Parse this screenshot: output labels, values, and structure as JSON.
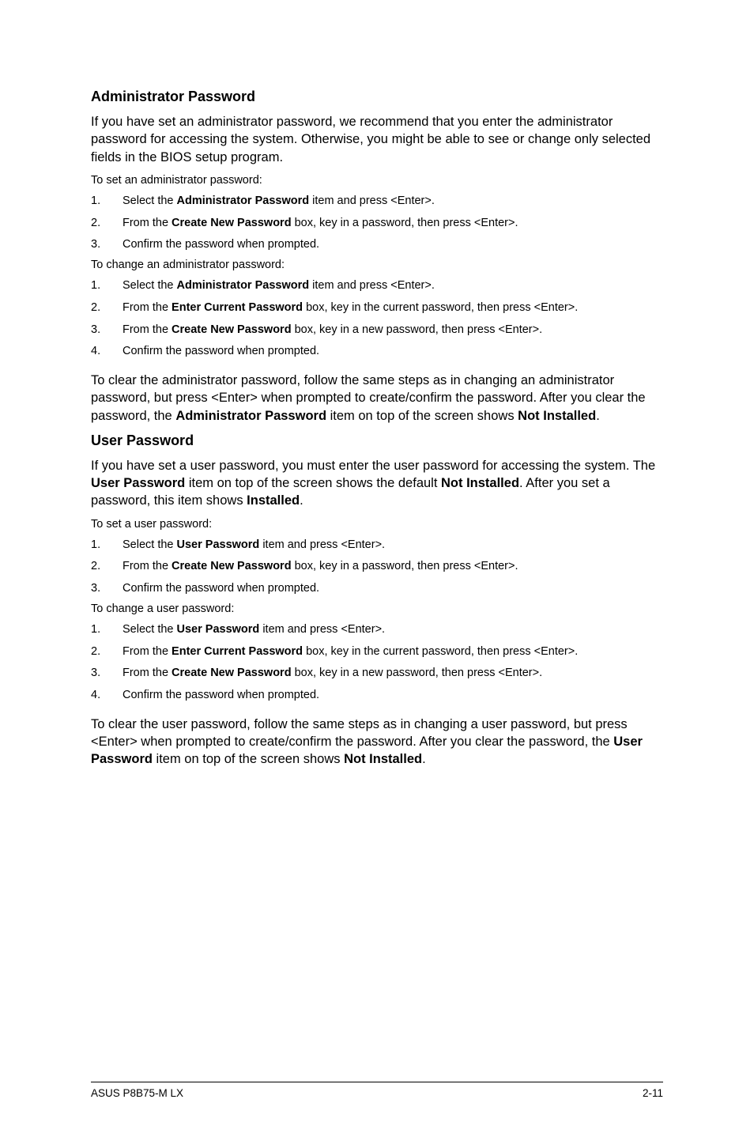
{
  "section1": {
    "heading": "Administrator Password",
    "intro": "If you have set an administrator password, we recommend that you enter the administrator password for accessing the system. Otherwise, you might be able to see or change only selected fields in the BIOS setup program.",
    "setLead": "To set an administrator password:",
    "set1_a": "Select the ",
    "set1_b": "Administrator Password",
    "set1_c": " item and press <Enter>.",
    "set2_a": "From the ",
    "set2_b": "Create New Password",
    "set2_c": " box, key in a password, then press <Enter>.",
    "set3": "Confirm the password when prompted.",
    "changeLead": "To change an administrator password:",
    "chg1_a": "Select the ",
    "chg1_b": "Administrator Password",
    "chg1_c": " item and press <Enter>.",
    "chg2_a": "From the ",
    "chg2_b": "Enter Current Password",
    "chg2_c": " box, key in the current password, then press <Enter>.",
    "chg3_a": "From the ",
    "chg3_b": "Create New Password",
    "chg3_c": " box, key in a new password, then press <Enter>.",
    "chg4": "Confirm the password when prompted.",
    "clear_a": "To clear the administrator password, follow the same steps as in changing an administrator password, but press <Enter> when prompted to create/confirm the password. After you clear the password, the ",
    "clear_b": "Administrator Password",
    "clear_c": " item on top of the screen shows ",
    "clear_d": "Not Installed",
    "clear_e": "."
  },
  "section2": {
    "heading": "User Password",
    "intro_a": "If you have set a user password, you must enter the user password for accessing the system. The ",
    "intro_b": "User Password",
    "intro_c": " item on top of the screen shows the default ",
    "intro_d": "Not Installed",
    "intro_e": ". After you set a password, this item shows ",
    "intro_f": "Installed",
    "intro_g": ".",
    "setLead": "To set a user password:",
    "set1_a": "Select the ",
    "set1_b": "User Password",
    "set1_c": " item and press <Enter>.",
    "set2_a": "From the ",
    "set2_b": "Create New Password",
    "set2_c": " box, key in a password, then press <Enter>.",
    "set3": "Confirm the password when prompted.",
    "changeLead": "To change a user password:",
    "chg1_a": "Select the ",
    "chg1_b": "User Password",
    "chg1_c": " item and press <Enter>.",
    "chg2_a": "From the ",
    "chg2_b": "Enter Current Password",
    "chg2_c": " box, key in the current password, then press <Enter>.",
    "chg3_a": "From the ",
    "chg3_b": "Create New Password",
    "chg3_c": " box, key in a new password, then press <Enter>.",
    "chg4": "Confirm the password when prompted.",
    "clear_a": "To clear the user password, follow the same steps as in changing a user password, but press <Enter> when prompted to create/confirm the password. After you clear the password, the ",
    "clear_b": "User Password",
    "clear_c": " item on top of the screen shows ",
    "clear_d": "Not Installed",
    "clear_e": "."
  },
  "footer": {
    "left": "ASUS P8B75-M LX",
    "right": "2-11"
  },
  "nums": {
    "n1": "1.",
    "n2": "2.",
    "n3": "3.",
    "n4": "4."
  }
}
